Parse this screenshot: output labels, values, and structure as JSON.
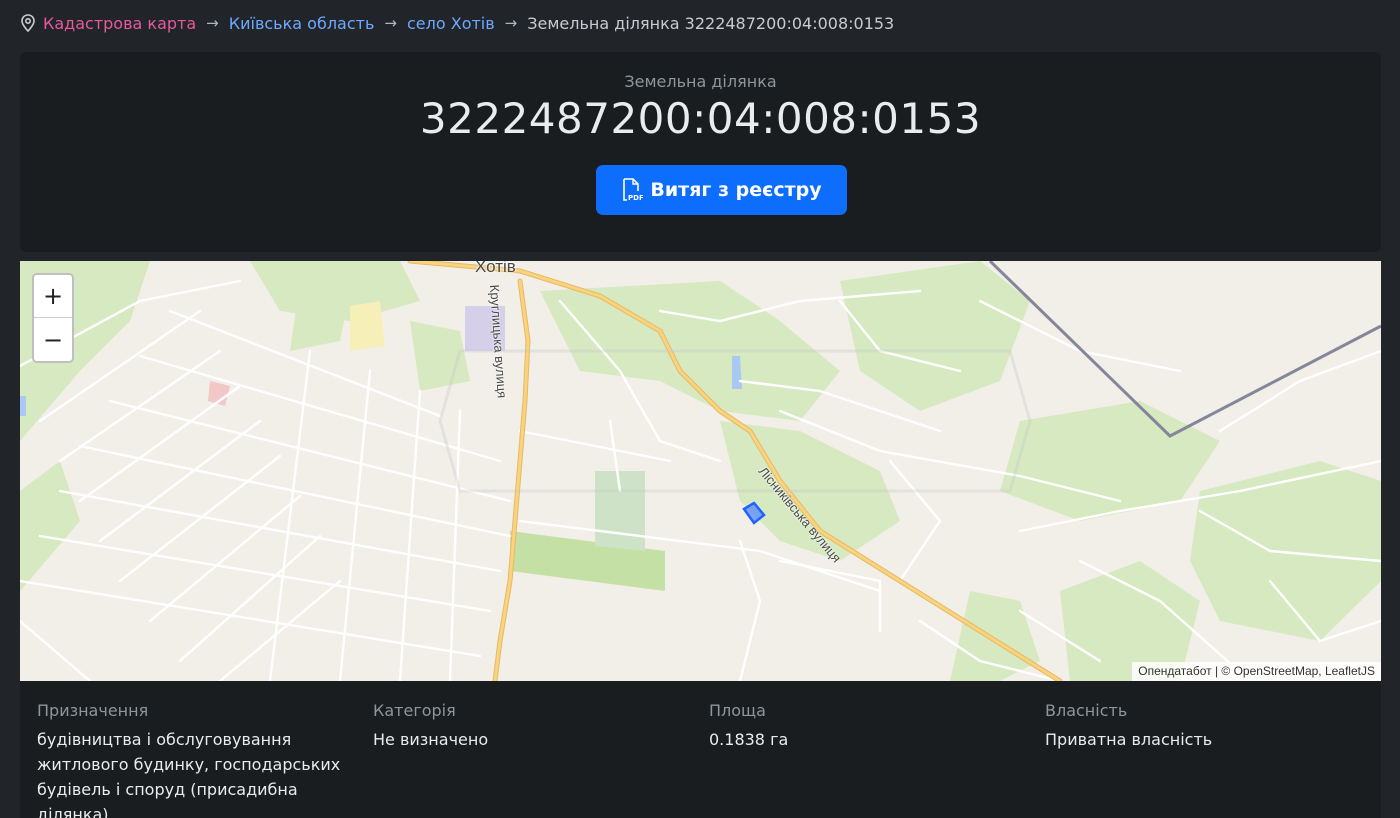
{
  "breadcrumb": {
    "home": "Кадастрова карта",
    "region": "Київська область",
    "village": "село Хотів",
    "current": "Земельна ділянка 3222487200:04:008:0153"
  },
  "header": {
    "subtitle": "Земельна ділянка",
    "cadastral_number": "3222487200:04:008:0153",
    "pdf_button_label": "Витяг з реєстру"
  },
  "map": {
    "zoom_in": "+",
    "zoom_out": "−",
    "place_label": "Хотів",
    "street_1": "Круглицька вулиця",
    "street_2": "Лісниківська вулиця",
    "attribution": "Опендатабот | © OpenStreetMap, LeafletJS",
    "colors": {
      "background": "#f2efe9",
      "green": "#d6e9c1",
      "major_road": "#f4c36a",
      "parcel": "#1e63ff",
      "boundary": "#85869a"
    }
  },
  "details": [
    {
      "label": "Призначення",
      "value": "будівництва і обслуговування житлового будинку, господарських будівель і споруд (присадибна ділянка)"
    },
    {
      "label": "Категорія",
      "value": "Не визначено"
    },
    {
      "label": "Площа",
      "value": "0.1838 га"
    },
    {
      "label": "Власність",
      "value": "Приватна власність"
    }
  ]
}
